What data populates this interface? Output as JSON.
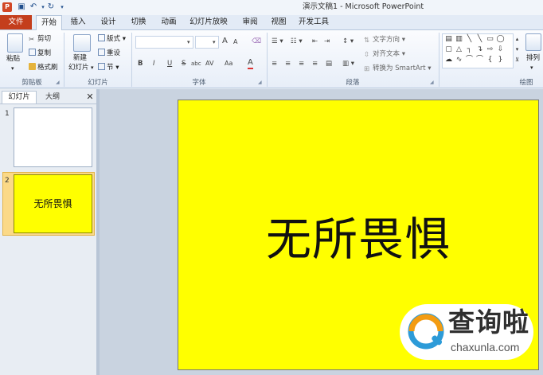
{
  "window": {
    "title": "演示文稿1 - Microsoft PowerPoint",
    "app_badge": "P"
  },
  "quick_access": {
    "save_icon": "save-icon",
    "undo_icon": "undo-icon",
    "redo_icon": "redo-icon"
  },
  "tabs": {
    "file": "文件",
    "home": "开始",
    "insert": "插入",
    "design": "设计",
    "transitions": "切换",
    "animations": "动画",
    "slideshow": "幻灯片放映",
    "review": "审阅",
    "view": "视图",
    "developer": "开发工具"
  },
  "ribbon": {
    "clipboard": {
      "paste": "粘贴",
      "cut": "剪切",
      "copy": "复制",
      "format_painter": "格式刷",
      "label": "剪贴板"
    },
    "slides": {
      "new_slide": "新建",
      "new_slide_line2": "幻灯片",
      "layout": "版式",
      "reset": "重设",
      "section": "节",
      "label": "幻灯片"
    },
    "font": {
      "bold": "B",
      "italic": "I",
      "underline": "U",
      "strike": "S",
      "shadow": "abc",
      "spacing": "AV",
      "case": "Aa",
      "color": "A",
      "grow": "A",
      "shrink": "A",
      "label": "字体"
    },
    "paragraph": {
      "text_direction": "文字方向",
      "align_text": "对齐文本",
      "smartart": "转换为 SmartArt",
      "label": "段落"
    },
    "drawing": {
      "arrange": "排列",
      "label": "绘图"
    }
  },
  "left_panel": {
    "tab_slides": "幻灯片",
    "tab_outline": "大纲",
    "close": "✕",
    "slides": [
      {
        "number": "1",
        "text": ""
      },
      {
        "number": "2",
        "text": "无所畏惧"
      }
    ]
  },
  "slide": {
    "text": "无所畏惧",
    "background": "#ffff00"
  },
  "watermark": {
    "cn": "查询啦",
    "en": "chaxunla.com"
  },
  "colors": {
    "file_tab": "#c43e1c",
    "slide_bg": "#ffff00",
    "selected_thumb": "#fbd987",
    "watermark_blue": "#2d9bd8"
  }
}
